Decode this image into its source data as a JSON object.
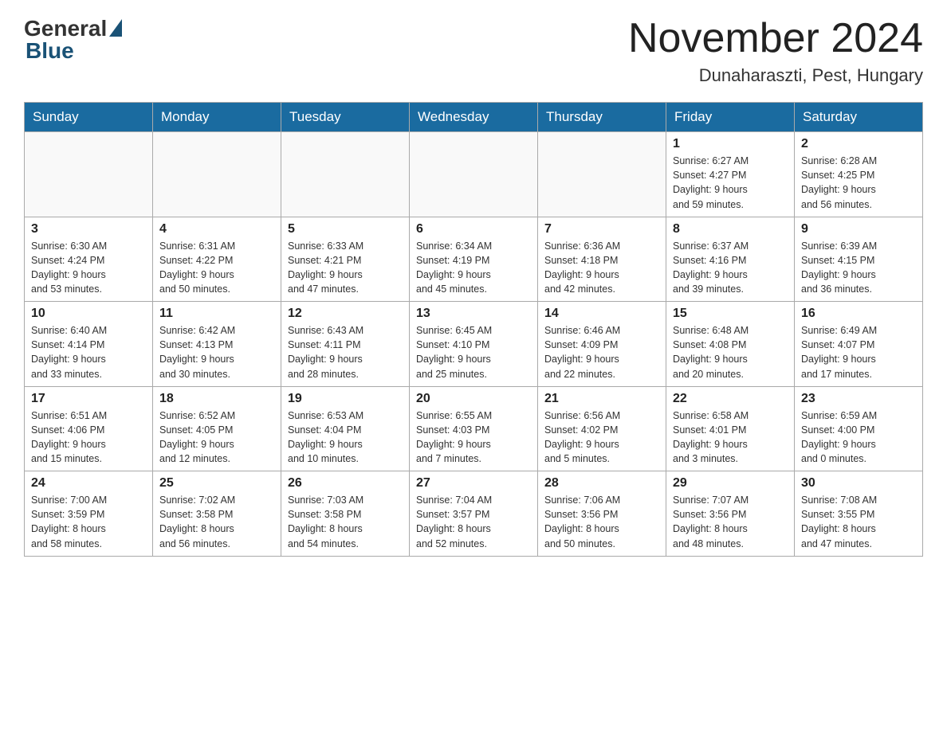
{
  "header": {
    "logo_general": "General",
    "logo_blue": "Blue",
    "month_title": "November 2024",
    "location": "Dunaharaszti, Pest, Hungary"
  },
  "days_of_week": [
    "Sunday",
    "Monday",
    "Tuesday",
    "Wednesday",
    "Thursday",
    "Friday",
    "Saturday"
  ],
  "weeks": [
    [
      {
        "day": "",
        "info": ""
      },
      {
        "day": "",
        "info": ""
      },
      {
        "day": "",
        "info": ""
      },
      {
        "day": "",
        "info": ""
      },
      {
        "day": "",
        "info": ""
      },
      {
        "day": "1",
        "info": "Sunrise: 6:27 AM\nSunset: 4:27 PM\nDaylight: 9 hours\nand 59 minutes."
      },
      {
        "day": "2",
        "info": "Sunrise: 6:28 AM\nSunset: 4:25 PM\nDaylight: 9 hours\nand 56 minutes."
      }
    ],
    [
      {
        "day": "3",
        "info": "Sunrise: 6:30 AM\nSunset: 4:24 PM\nDaylight: 9 hours\nand 53 minutes."
      },
      {
        "day": "4",
        "info": "Sunrise: 6:31 AM\nSunset: 4:22 PM\nDaylight: 9 hours\nand 50 minutes."
      },
      {
        "day": "5",
        "info": "Sunrise: 6:33 AM\nSunset: 4:21 PM\nDaylight: 9 hours\nand 47 minutes."
      },
      {
        "day": "6",
        "info": "Sunrise: 6:34 AM\nSunset: 4:19 PM\nDaylight: 9 hours\nand 45 minutes."
      },
      {
        "day": "7",
        "info": "Sunrise: 6:36 AM\nSunset: 4:18 PM\nDaylight: 9 hours\nand 42 minutes."
      },
      {
        "day": "8",
        "info": "Sunrise: 6:37 AM\nSunset: 4:16 PM\nDaylight: 9 hours\nand 39 minutes."
      },
      {
        "day": "9",
        "info": "Sunrise: 6:39 AM\nSunset: 4:15 PM\nDaylight: 9 hours\nand 36 minutes."
      }
    ],
    [
      {
        "day": "10",
        "info": "Sunrise: 6:40 AM\nSunset: 4:14 PM\nDaylight: 9 hours\nand 33 minutes."
      },
      {
        "day": "11",
        "info": "Sunrise: 6:42 AM\nSunset: 4:13 PM\nDaylight: 9 hours\nand 30 minutes."
      },
      {
        "day": "12",
        "info": "Sunrise: 6:43 AM\nSunset: 4:11 PM\nDaylight: 9 hours\nand 28 minutes."
      },
      {
        "day": "13",
        "info": "Sunrise: 6:45 AM\nSunset: 4:10 PM\nDaylight: 9 hours\nand 25 minutes."
      },
      {
        "day": "14",
        "info": "Sunrise: 6:46 AM\nSunset: 4:09 PM\nDaylight: 9 hours\nand 22 minutes."
      },
      {
        "day": "15",
        "info": "Sunrise: 6:48 AM\nSunset: 4:08 PM\nDaylight: 9 hours\nand 20 minutes."
      },
      {
        "day": "16",
        "info": "Sunrise: 6:49 AM\nSunset: 4:07 PM\nDaylight: 9 hours\nand 17 minutes."
      }
    ],
    [
      {
        "day": "17",
        "info": "Sunrise: 6:51 AM\nSunset: 4:06 PM\nDaylight: 9 hours\nand 15 minutes."
      },
      {
        "day": "18",
        "info": "Sunrise: 6:52 AM\nSunset: 4:05 PM\nDaylight: 9 hours\nand 12 minutes."
      },
      {
        "day": "19",
        "info": "Sunrise: 6:53 AM\nSunset: 4:04 PM\nDaylight: 9 hours\nand 10 minutes."
      },
      {
        "day": "20",
        "info": "Sunrise: 6:55 AM\nSunset: 4:03 PM\nDaylight: 9 hours\nand 7 minutes."
      },
      {
        "day": "21",
        "info": "Sunrise: 6:56 AM\nSunset: 4:02 PM\nDaylight: 9 hours\nand 5 minutes."
      },
      {
        "day": "22",
        "info": "Sunrise: 6:58 AM\nSunset: 4:01 PM\nDaylight: 9 hours\nand 3 minutes."
      },
      {
        "day": "23",
        "info": "Sunrise: 6:59 AM\nSunset: 4:00 PM\nDaylight: 9 hours\nand 0 minutes."
      }
    ],
    [
      {
        "day": "24",
        "info": "Sunrise: 7:00 AM\nSunset: 3:59 PM\nDaylight: 8 hours\nand 58 minutes."
      },
      {
        "day": "25",
        "info": "Sunrise: 7:02 AM\nSunset: 3:58 PM\nDaylight: 8 hours\nand 56 minutes."
      },
      {
        "day": "26",
        "info": "Sunrise: 7:03 AM\nSunset: 3:58 PM\nDaylight: 8 hours\nand 54 minutes."
      },
      {
        "day": "27",
        "info": "Sunrise: 7:04 AM\nSunset: 3:57 PM\nDaylight: 8 hours\nand 52 minutes."
      },
      {
        "day": "28",
        "info": "Sunrise: 7:06 AM\nSunset: 3:56 PM\nDaylight: 8 hours\nand 50 minutes."
      },
      {
        "day": "29",
        "info": "Sunrise: 7:07 AM\nSunset: 3:56 PM\nDaylight: 8 hours\nand 48 minutes."
      },
      {
        "day": "30",
        "info": "Sunrise: 7:08 AM\nSunset: 3:55 PM\nDaylight: 8 hours\nand 47 minutes."
      }
    ]
  ]
}
